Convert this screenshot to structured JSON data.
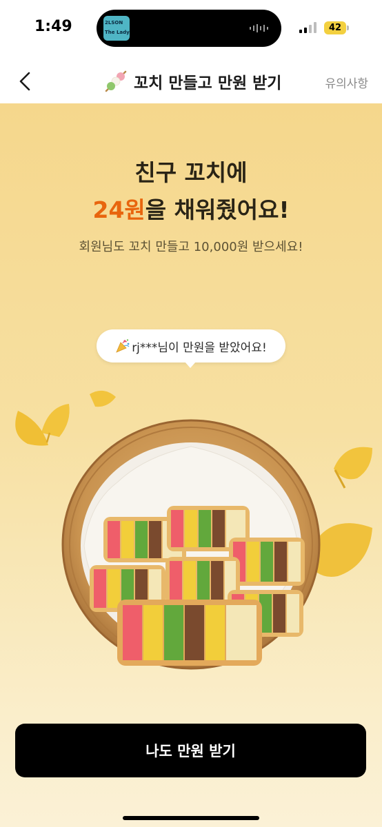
{
  "status_bar": {
    "time": "1:49",
    "battery": "42",
    "island_thumb_line1": "2LSON",
    "island_thumb_line2": "The Lady"
  },
  "nav": {
    "title": "꼬치 만들고 만원 받기",
    "title_icon": "skewer-dango-icon",
    "notice_label": "유의사항"
  },
  "hero": {
    "headline_line1": "친구 꼬치에",
    "headline_amount": "24원",
    "headline_rest": "을 채워줬어요!",
    "subtitle": "회원님도 꼬치 만들고 10,000원 받으세요!"
  },
  "toast": {
    "emoji": "party-popper-icon",
    "text": "rj***님이 만원을 받았어요!"
  },
  "cta": {
    "label": "나도 만원 받기"
  },
  "colors": {
    "accent_amount": "#e8650e",
    "background_top": "#f5d78c",
    "background_bottom": "#fbf1d6",
    "cta_background": "#000000"
  }
}
